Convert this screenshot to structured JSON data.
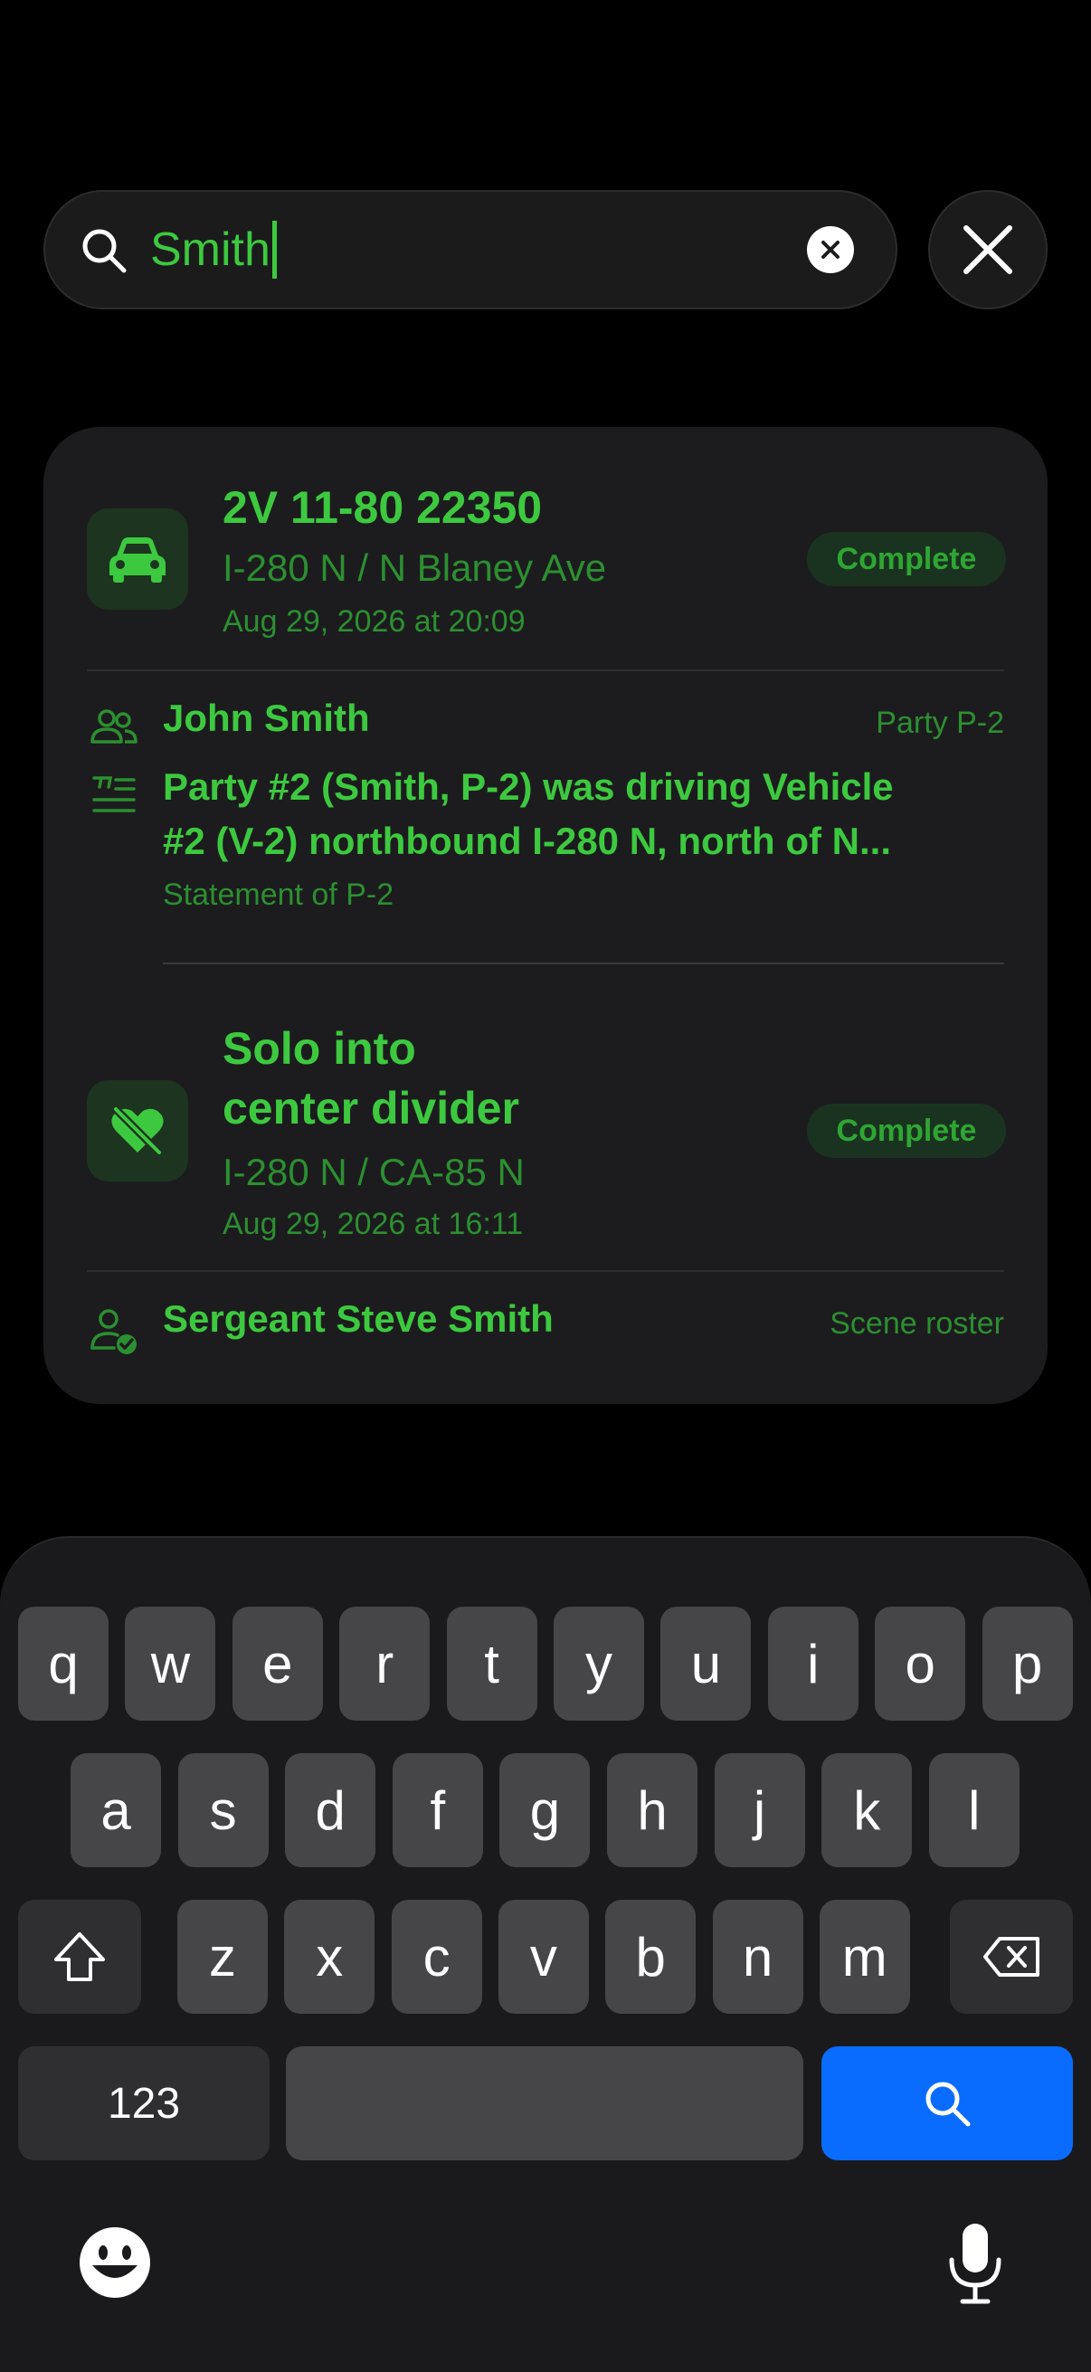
{
  "search": {
    "query": "Smith",
    "clear_icon": "xmark-circle-icon",
    "close_icon": "xmark-icon"
  },
  "colors": {
    "accent_green": "#3dc93f",
    "muted_green": "#2c8f31",
    "keyboard_blue": "#0a6cff"
  },
  "results": {
    "incident1": {
      "icon": "car-icon",
      "title": "2V 11-80 22350",
      "location": "I-280 N / N Blaney Ave",
      "datetime": "Aug 29, 2026 at 20:09",
      "status": "Complete",
      "person": {
        "icon": "people-icon",
        "name": "John Smith",
        "tag": "Party P-2"
      },
      "statement": {
        "icon": "quote-text-icon",
        "line1": "Party #2 (Smith, P-2) was driving Vehicle",
        "line2": "#2 (V-2) northbound I-280 N, north of N...",
        "caption": "Statement of P-2"
      }
    },
    "incident2": {
      "icon": "heart-slash-icon",
      "title_line1": "Solo into",
      "title_line2": "center divider",
      "location": "I-280 N / CA-85 N",
      "datetime": "Aug 29, 2026 at 16:11",
      "status": "Complete",
      "person": {
        "icon": "person-check-icon",
        "name": "Sergeant Steve Smith",
        "tag": "Scene roster"
      }
    }
  },
  "keyboard": {
    "row1": [
      "q",
      "w",
      "e",
      "r",
      "t",
      "y",
      "u",
      "i",
      "o",
      "p"
    ],
    "row2": [
      "a",
      "s",
      "d",
      "f",
      "g",
      "h",
      "j",
      "k",
      "l"
    ],
    "row3": [
      "z",
      "x",
      "c",
      "v",
      "b",
      "n",
      "m"
    ],
    "numbers_label": "123",
    "shift_icon": "shift-icon",
    "delete_icon": "delete-backward-icon",
    "search_icon": "search-icon",
    "emoji_icon": "emoji-icon",
    "mic_icon": "microphone-icon"
  }
}
